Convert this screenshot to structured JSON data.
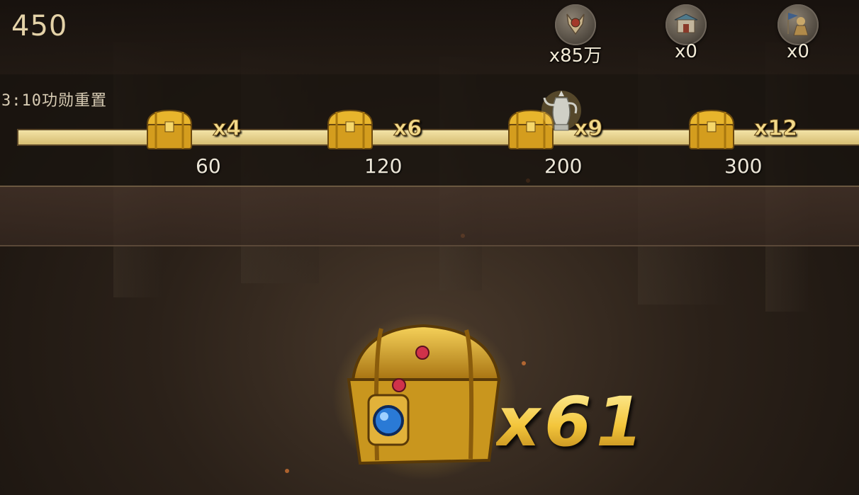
{
  "header": {
    "score": "450",
    "resources": [
      {
        "icon": "helmet-armor-icon",
        "count": "x85万"
      },
      {
        "icon": "palace-gate-icon",
        "count": "x0"
      },
      {
        "icon": "general-banner-icon",
        "count": "x0"
      }
    ]
  },
  "progress": {
    "reset_text": "3:10功勋重置",
    "milestones": [
      {
        "icon": "treasure-chest-icon",
        "multiplier": "x4",
        "points": "60"
      },
      {
        "icon": "treasure-chest-icon",
        "multiplier": "x6",
        "points": "120"
      },
      {
        "icon": "treasure-chest-icon",
        "multiplier": "x9",
        "points": "200",
        "extra_icon": "silver-ewer-icon"
      },
      {
        "icon": "treasure-chest-icon",
        "multiplier": "x12",
        "points": "300"
      }
    ]
  },
  "reward": {
    "icon": "jeweled-treasure-chest-icon",
    "multiplier": "x61"
  },
  "colors": {
    "gold": "#f3c53b",
    "track": "#e6d08a",
    "background": "#2b2119"
  }
}
